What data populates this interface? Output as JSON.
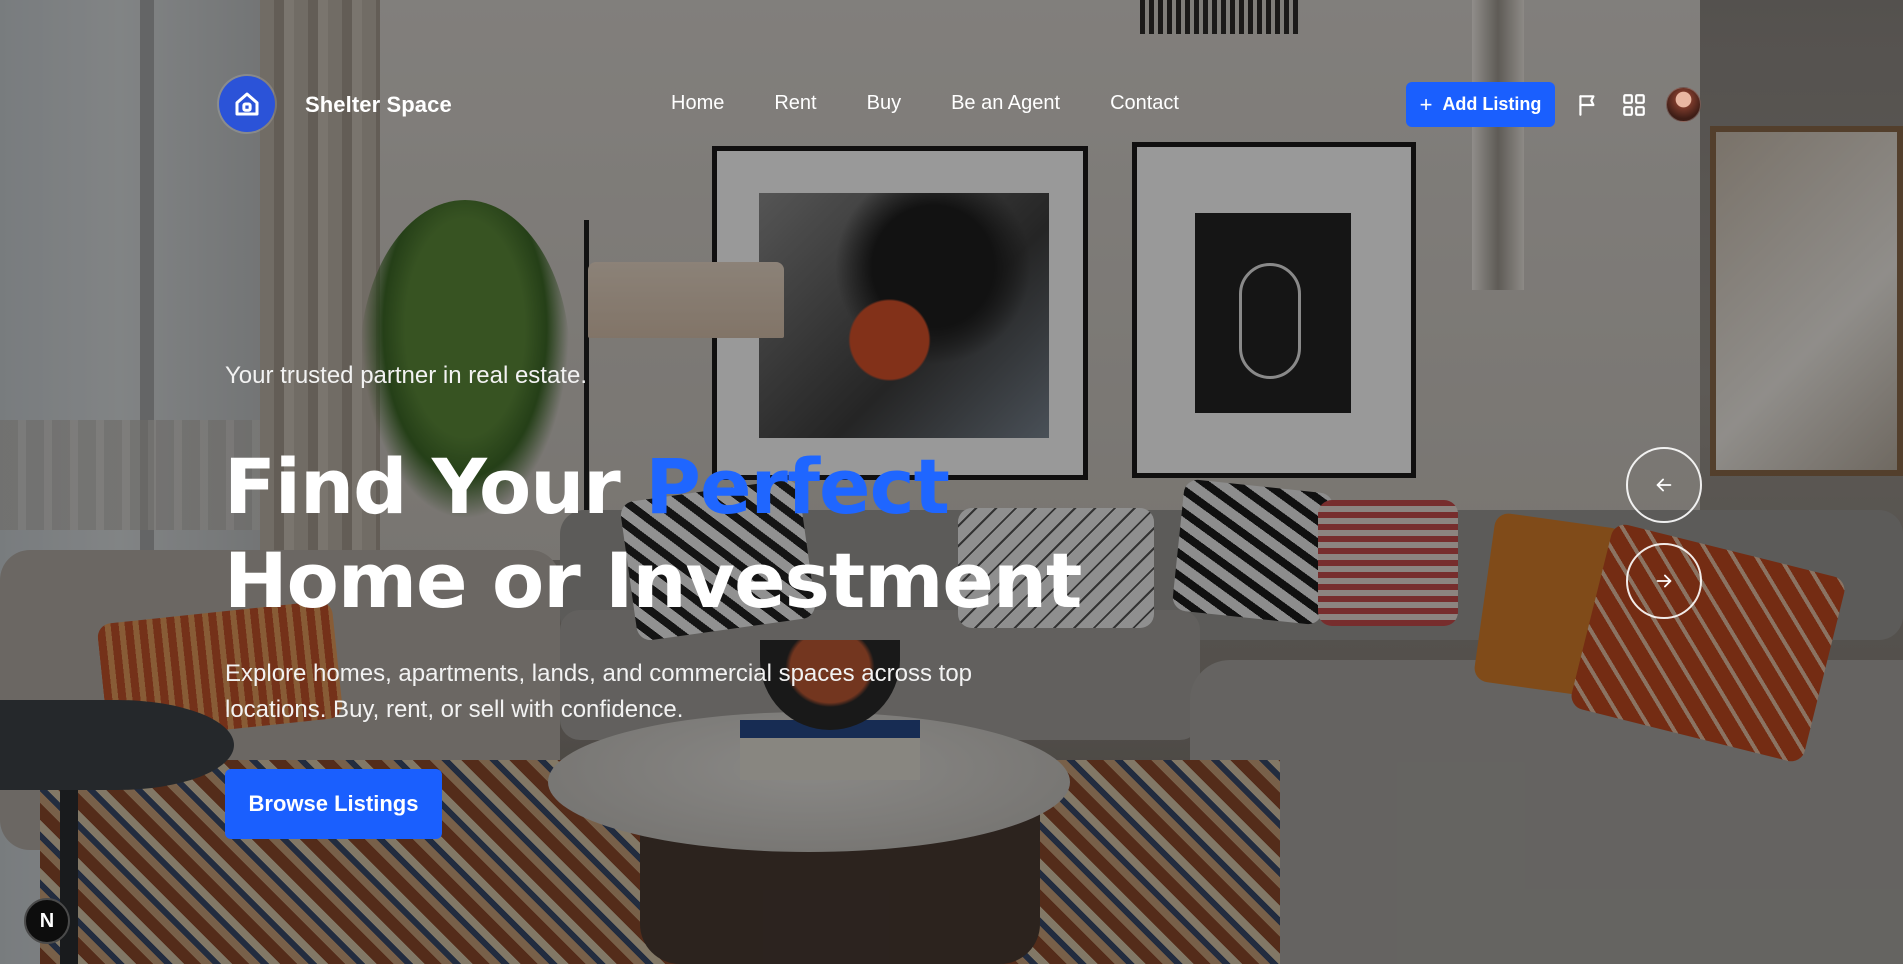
{
  "header": {
    "brand": "Shelter Space",
    "logo_icon": "home-icon",
    "nav": [
      {
        "label": "Home"
      },
      {
        "label": "Rent"
      },
      {
        "label": "Buy"
      },
      {
        "label": "Be an Agent"
      },
      {
        "label": "Contact"
      }
    ],
    "add_listing_label": "Add Listing",
    "icons": [
      "plus-icon",
      "flag-icon",
      "grid-icon",
      "avatar"
    ]
  },
  "hero": {
    "tagline": "Your trusted partner in real estate.",
    "headline_part1": "Find Your ",
    "headline_accent": "Perfect",
    "headline_line2": "Home or Investment",
    "description": "Explore homes, apartments, lands, and commercial spaces across top locations. Buy, rent, or sell with confidence.",
    "cta_label": "Browse Listings"
  },
  "carousel": {
    "prev_icon": "arrow-left-icon",
    "next_icon": "arrow-right-icon"
  },
  "dev_badge": {
    "label": "N"
  },
  "colors": {
    "accent": "#1a5ffe",
    "logo_bg": "#2b53d8",
    "headline_accent": "#1f66ff"
  }
}
